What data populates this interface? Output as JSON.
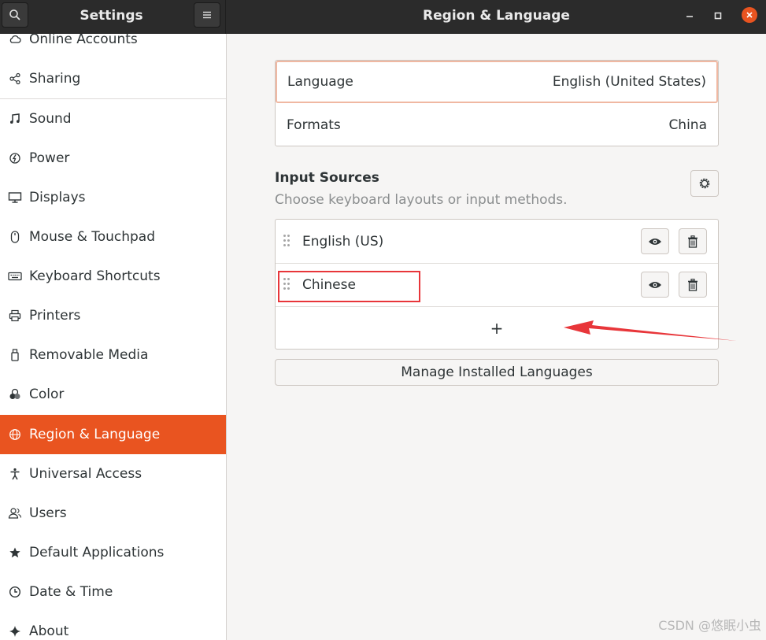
{
  "header": {
    "sidebar_title": "Settings",
    "main_title": "Region & Language",
    "search_icon": "search-icon",
    "menu_icon": "hamburger-menu-icon"
  },
  "sidebar": {
    "items": [
      {
        "label": "Online Accounts",
        "icon": "cloud-icon"
      },
      {
        "label": "Sharing",
        "icon": "share-icon"
      },
      {
        "label": "Sound",
        "icon": "music-note-icon"
      },
      {
        "label": "Power",
        "icon": "power-icon"
      },
      {
        "label": "Displays",
        "icon": "display-icon"
      },
      {
        "label": "Mouse & Touchpad",
        "icon": "mouse-icon"
      },
      {
        "label": "Keyboard Shortcuts",
        "icon": "keyboard-icon"
      },
      {
        "label": "Printers",
        "icon": "printer-icon"
      },
      {
        "label": "Removable Media",
        "icon": "usb-drive-icon"
      },
      {
        "label": "Color",
        "icon": "color-icon"
      },
      {
        "label": "Region & Language",
        "icon": "globe-icon"
      },
      {
        "label": "Universal Access",
        "icon": "accessibility-icon"
      },
      {
        "label": "Users",
        "icon": "users-icon"
      },
      {
        "label": "Default Applications",
        "icon": "star-icon"
      },
      {
        "label": "Date & Time",
        "icon": "clock-icon"
      },
      {
        "label": "About",
        "icon": "sparkle-icon"
      }
    ],
    "active_label": "Region & Language"
  },
  "language_settings": {
    "language_label": "Language",
    "language_value": "English (United States)",
    "formats_label": "Formats",
    "formats_value": "China"
  },
  "input_sources": {
    "title": "Input Sources",
    "subtitle": "Choose keyboard layouts or input methods.",
    "sources": [
      {
        "label": "English (US)"
      },
      {
        "label": "Chinese"
      }
    ],
    "add_label": "+"
  },
  "manage_button_label": "Manage Installed Languages",
  "watermark": "CSDN @悠眠小虫",
  "colors": {
    "accent": "#e95420",
    "annotation_red": "#e8363a"
  }
}
